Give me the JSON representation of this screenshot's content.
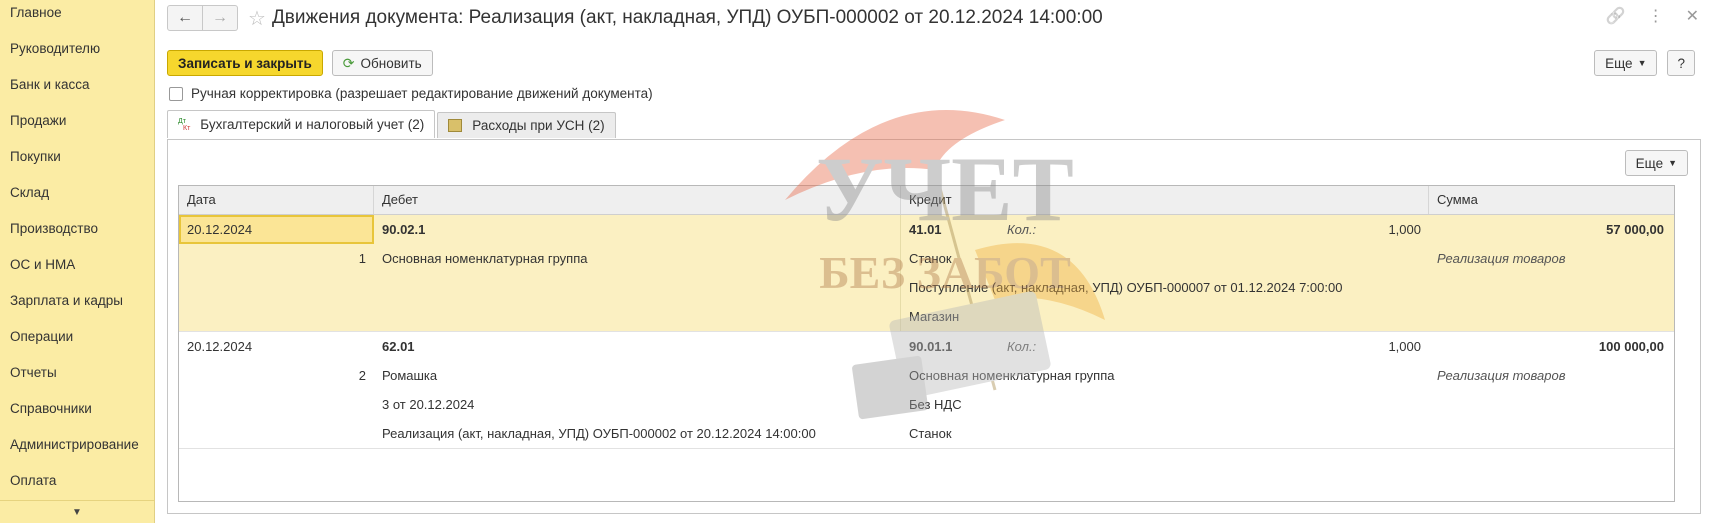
{
  "sidebar": {
    "items": [
      "Главное",
      "Руководителю",
      "Банк и касса",
      "Продажи",
      "Покупки",
      "Склад",
      "Производство",
      "ОС и НМА",
      "Зарплата и кадры",
      "Операции",
      "Отчеты",
      "Справочники",
      "Администрирование",
      "Оплата"
    ]
  },
  "header": {
    "back_icon": "←",
    "forward_icon": "→",
    "star_icon": "☆",
    "title": "Движения документа: Реализация (акт, накладная, УПД) ОУБП-000002 от 20.12.2024 14:00:00",
    "link_icon": "🔗",
    "menu_icon": "⋮",
    "close_icon": "✕"
  },
  "toolbar": {
    "save_close": "Записать и закрыть",
    "refresh_icon": "⟳",
    "refresh": "Обновить",
    "more": "Еще",
    "help": "?"
  },
  "manual_correction": {
    "label": "Ручная корректировка (разрешает редактирование движений документа)",
    "checked": false
  },
  "tabs": [
    {
      "label": "Бухгалтерский и налоговый учет (2)",
      "active": true
    },
    {
      "label": "Расходы при УСН (2)",
      "active": false
    }
  ],
  "panel": {
    "more": "Еще"
  },
  "table": {
    "columns": [
      "Дата",
      "Дебет",
      "Кредит",
      "Сумма"
    ],
    "rows": [
      {
        "date": "20.12.2024",
        "n": "1",
        "debit_account": "90.02.1",
        "debit_sub": [
          "Основная номенклатурная группа"
        ],
        "credit_account": "41.01",
        "qty_label": "Кол.:",
        "qty": "1,000",
        "credit_sub": [
          "Станок",
          "Поступление (акт, накладная, УПД) ОУБП-000007 от 01.12.2024 7:00:00",
          "Магазин"
        ],
        "amount": "57 000,00",
        "content": "Реализация товаров"
      },
      {
        "date": "20.12.2024",
        "n": "2",
        "debit_account": "62.01",
        "debit_sub": [
          "Ромашка",
          "3 от 20.12.2024",
          "Реализация (акт, накладная, УПД) ОУБП-000002 от 20.12.2024 14:00:00"
        ],
        "credit_account": "90.01.1",
        "qty_label": "Кол.:",
        "qty": "1,000",
        "credit_sub": [
          "Основная номенклатурная группа",
          "Без НДС",
          "Станок"
        ],
        "amount": "100 000,00",
        "content": "Реализация товаров"
      }
    ]
  },
  "watermark": {
    "line1": "УЧЕТ",
    "line2": "БЕЗ ЗАБОТ"
  },
  "colors": {
    "sidebar": "#fbeca4",
    "primary_button": "#f6d72d",
    "selected_row": "#fbf0c2"
  }
}
